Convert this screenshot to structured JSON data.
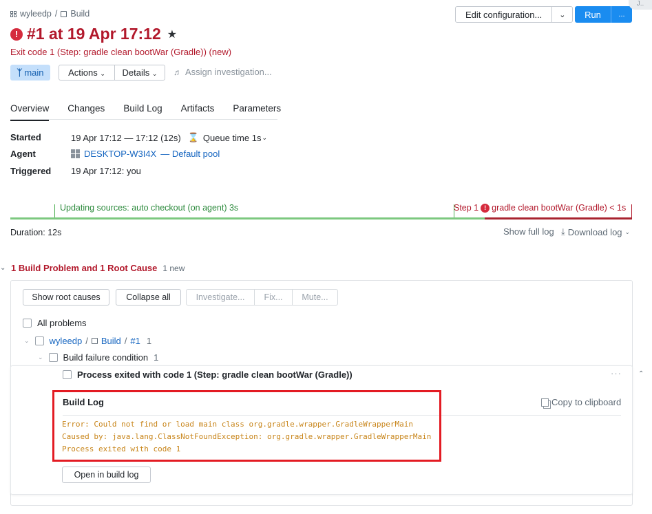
{
  "breadcrumb": {
    "project": "wyleedp",
    "separator": "/",
    "build_config": "Build"
  },
  "header": {
    "edit_configuration": "Edit configuration...",
    "run": "Run",
    "run_more": "...",
    "corner_text": "J.."
  },
  "build": {
    "title": "#1 at 19 Apr 17:12",
    "status": "Exit code 1 (Step: gradle clean bootWar (Gradle)) (new)",
    "branch": "main",
    "actions": "Actions",
    "details": "Details",
    "assign": "Assign investigation..."
  },
  "tabs": [
    "Overview",
    "Changes",
    "Build Log",
    "Artifacts",
    "Parameters"
  ],
  "info": {
    "started_label": "Started",
    "started_value": "19 Apr 17:12 — 17:12 (12s)",
    "queue_time": "Queue time 1s",
    "agent_label": "Agent",
    "agent_name": "DESKTOP-W3I4X",
    "agent_pool": "— Default pool",
    "triggered_label": "Triggered",
    "triggered_value": "19 Apr 17:12: you"
  },
  "timeline": {
    "step1_label": "Updating sources: auto checkout (on agent) 3s",
    "step2_prefix": "Step 1",
    "step2_label": "gradle clean bootWar (Gradle) < 1s",
    "duration": "Duration: 12s",
    "show_full_log": "Show full log",
    "download_log": "Download log"
  },
  "problems": {
    "title": "1 Build Problem and 1 Root Cause",
    "new_count": "1 new",
    "show_root_causes": "Show root causes",
    "collapse_all": "Collapse all",
    "investigate": "Investigate...",
    "fix": "Fix...",
    "mute": "Mute...",
    "all_problems": "All problems",
    "tree_project": "wyleedp",
    "tree_sep1": "/",
    "tree_build": "Build",
    "tree_sep2": "/",
    "tree_build_num": "#1",
    "tree_count": "1",
    "failure_condition": "Build failure condition",
    "failure_count": "1",
    "detail_title": "Process exited with code 1 (Step: gradle clean bootWar (Gradle))",
    "log_title": "Build Log",
    "copy_to_clipboard": "Copy to clipboard",
    "log_lines": [
      "Error: Could not find or load main class org.gradle.wrapper.GradleWrapperMain",
      "Caused by: java.lang.ClassNotFoundException: org.gradle.wrapper.GradleWrapperMain",
      "Process exited with code 1"
    ],
    "open_in_build_log": "Open in build log"
  },
  "colors": {
    "error": "#b2182b",
    "success": "#4caf50",
    "accent": "#1a8cf0",
    "highlight": "#e31b23",
    "log_text": "#c8851a"
  }
}
